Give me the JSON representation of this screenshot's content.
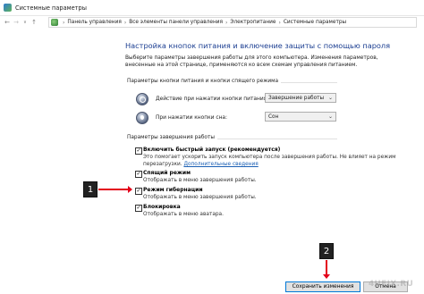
{
  "window": {
    "title": "Системные параметры"
  },
  "nav": {
    "back": "←",
    "forward": "→",
    "recent": "∨",
    "up": "↑",
    "breadcrumb": [
      "Панель управления",
      "Все элементы панели управления",
      "Электропитание",
      "Системные параметры"
    ],
    "separator": "›"
  },
  "page": {
    "title": "Настройка кнопок питания и включение защиты с помощью пароля",
    "description": "Выберите параметры завершения работы для этого компьютера. Изменения параметров, внесенные на этой странице, применяются ко всем схемам управления питанием."
  },
  "buttons_section": {
    "label": "Параметры кнопки питания и кнопки спящего режима",
    "rows": [
      {
        "label": "Действие при нажатии кнопки питания:",
        "value": "Завершение работы",
        "icon": "power-button-icon"
      },
      {
        "label": "При нажатии кнопки сна:",
        "value": "Сон",
        "icon": "sleep-button-icon"
      }
    ]
  },
  "shutdown_section": {
    "label": "Параметры завершения работы",
    "items": [
      {
        "title": "Включить быстрый запуск (рекомендуется)",
        "desc1": "Это помогает ускорить запуск компьютера после завершения работы. Не влияет на режим",
        "desc2": "перезагрузки.",
        "link": "Дополнительные сведения",
        "checked": "✓"
      },
      {
        "title": "Спящий режим",
        "desc1": "Отображать в меню завершения работы.",
        "checked": "✓"
      },
      {
        "title": "Режим гибернации",
        "desc1": "Отображать в меню завершения работы.",
        "checked": "✓"
      },
      {
        "title": "Блокировка",
        "desc1": "Отображать в меню аватара.",
        "checked": "✓"
      }
    ]
  },
  "callouts": {
    "one": "1",
    "two": "2",
    "arrow_color": "#e3001b"
  },
  "footer": {
    "save": "Сохранить изменения",
    "cancel": "Отмена"
  },
  "watermark": "4UFIX.RU",
  "colors": {
    "title_blue": "#1b3e91",
    "link_blue": "#1a5fb4"
  }
}
